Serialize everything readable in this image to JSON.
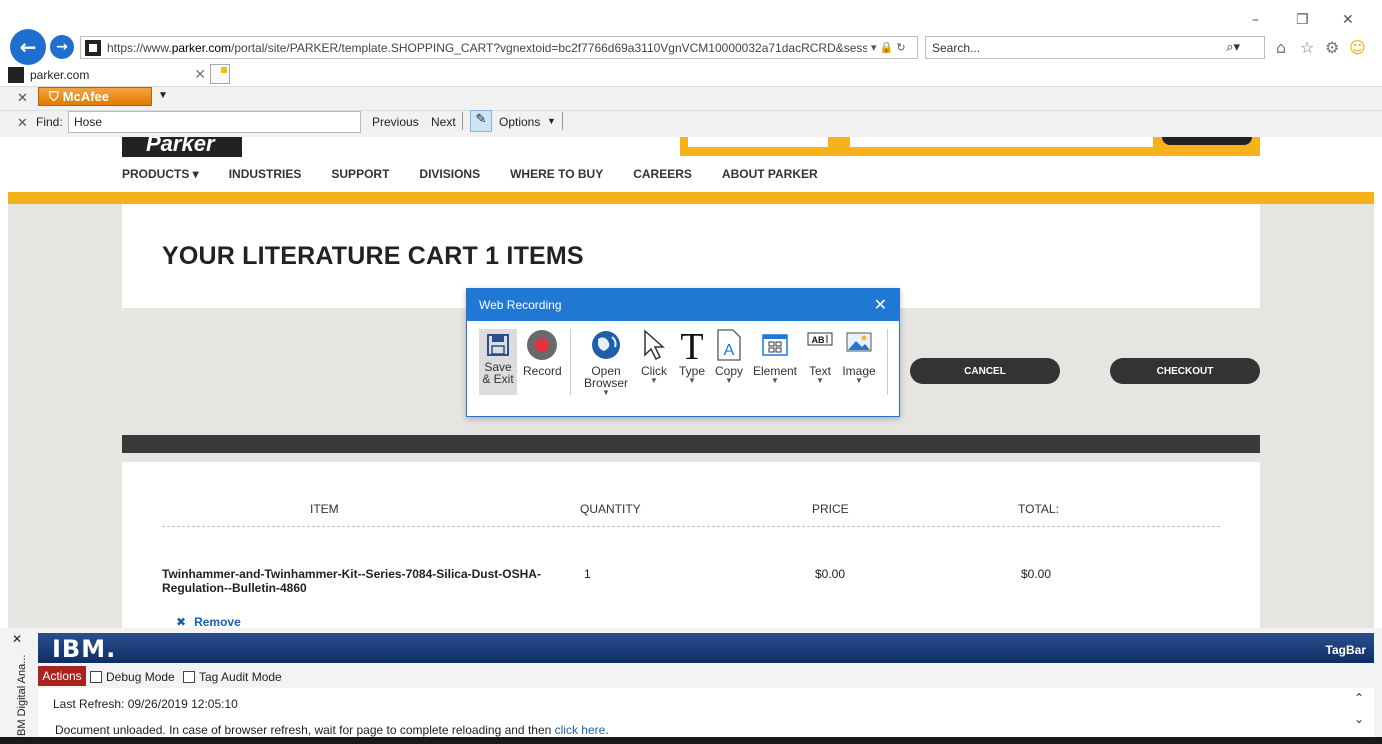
{
  "browser": {
    "url_prefix": "https://www.",
    "url_domain": "parker.com",
    "url_rest": "/portal/site/PARKER/template.SHOPPING_CART?vgnextoid=bc2f7766d69a3110VgnVCM10000032a71dacRCRD&sessionIc",
    "search_placeholder": "Search...",
    "tab_title": "parker.com",
    "window_controls": {
      "minimize": "–",
      "restore": "❐",
      "close": "✕"
    },
    "back_icon": "←",
    "forward_icon": "→"
  },
  "mcafee": {
    "label": "McAfee"
  },
  "find_bar": {
    "label": "Find:",
    "value": "Hose",
    "previous": "Previous",
    "next": "Next",
    "options": "Options"
  },
  "site": {
    "logo": "Parker",
    "nav": [
      "PRODUCTS ▾",
      "INDUSTRIES",
      "SUPPORT",
      "DIVISIONS",
      "WHERE TO BUY",
      "CAREERS",
      "ABOUT PARKER"
    ]
  },
  "cart": {
    "title": "YOUR LITERATURE CART 1 ITEMS",
    "cancel": "CANCEL",
    "checkout": "CHECKOUT",
    "headers": {
      "item": "ITEM",
      "quantity": "QUANTITY",
      "price": "PRICE",
      "total": "TOTAL:"
    },
    "row": {
      "item": "Twinhammer-and-Twinhammer-Kit--Series-7084-Silica-Dust-OSHA-Regulation--Bulletin-4860",
      "quantity": "1",
      "price": "$0.00",
      "total": "$0.00"
    },
    "remove": "Remove"
  },
  "recorder": {
    "title": "Web Recording",
    "tools": {
      "save": "Save & Exit",
      "record": "Record",
      "open_browser": "Open Browser",
      "click": "Click",
      "type": "Type",
      "copy": "Copy",
      "element": "Element",
      "text": "Text",
      "image": "Image"
    }
  },
  "tagbar": {
    "side_label": "IBM Digital Ana...",
    "logo": "IBM.",
    "name": "TagBar",
    "actions": "Actions",
    "debug_mode": "Debug Mode",
    "tag_audit_mode": "Tag Audit Mode",
    "last_refresh": "Last Refresh: 09/26/2019 12:05:10",
    "message": "Document unloaded. In case of browser refresh, wait for page to complete reloading and then",
    "link": "click here",
    "period": "."
  },
  "colors": {
    "accent_orange": "#f6b21b",
    "ie_blue": "#1f6fce",
    "dialog_blue": "#1e78d4",
    "ibm_blue": "#0e2d66"
  }
}
